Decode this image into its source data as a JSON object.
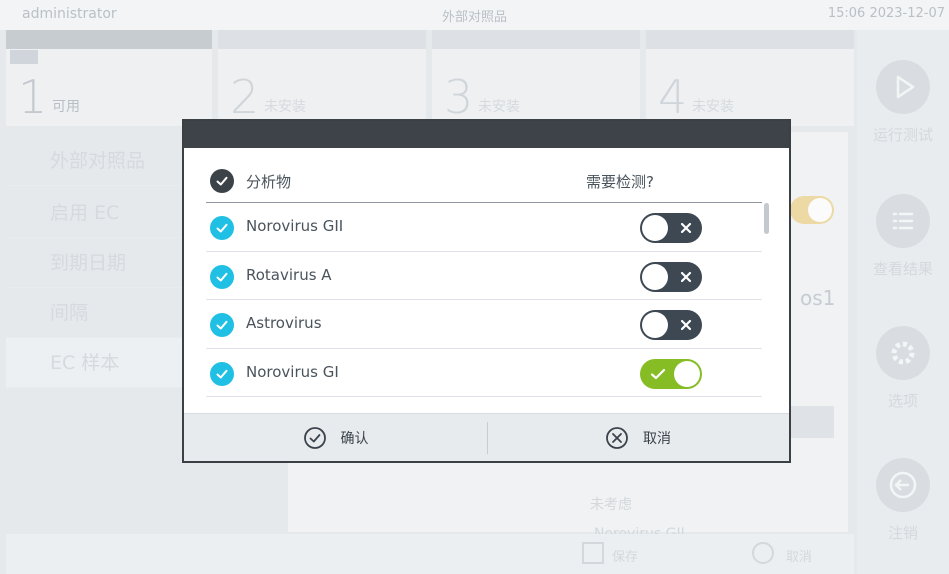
{
  "topbar": {
    "user": "administrator",
    "title": "外部对照品",
    "clock": "15:06 2023-12-07"
  },
  "tabs": [
    {
      "num": "1",
      "status": "可用",
      "mini": ""
    },
    {
      "num": "2",
      "status": "未安装"
    },
    {
      "num": "3",
      "status": "未安装"
    },
    {
      "num": "4",
      "status": "未安装"
    }
  ],
  "leftmenu": [
    "外部对照品",
    "启用 EC",
    "到期日期",
    "间隔",
    "EC 样本"
  ],
  "background": {
    "partial_text": "os1",
    "list": [
      "",
      "未考虑",
      "Norovirus GII"
    ]
  },
  "sidenav": [
    {
      "label": "运行测试",
      "icon": "play-icon"
    },
    {
      "label": "查看结果",
      "icon": "list-icon"
    },
    {
      "label": "选项",
      "icon": "gear-icon"
    },
    {
      "label": "注销",
      "icon": "logout-icon"
    }
  ],
  "bottombar": {
    "save": "保存",
    "cancel": "取消"
  },
  "modal": {
    "header_analyte": "分析物",
    "header_required": "需要检测?",
    "rows": [
      {
        "name": "Norovirus GII",
        "checked": true,
        "required": false
      },
      {
        "name": "Rotavirus A",
        "checked": true,
        "required": false
      },
      {
        "name": "Astrovirus",
        "checked": true,
        "required": false
      },
      {
        "name": "Norovirus GI",
        "checked": true,
        "required": true
      }
    ],
    "confirm": "确认",
    "cancel": "取消"
  },
  "colors": {
    "check_cyan": "#1fc0e4",
    "toggle_on": "#86bd24",
    "toggle_off": "#3d4852",
    "modal_header": "#3d4348"
  }
}
